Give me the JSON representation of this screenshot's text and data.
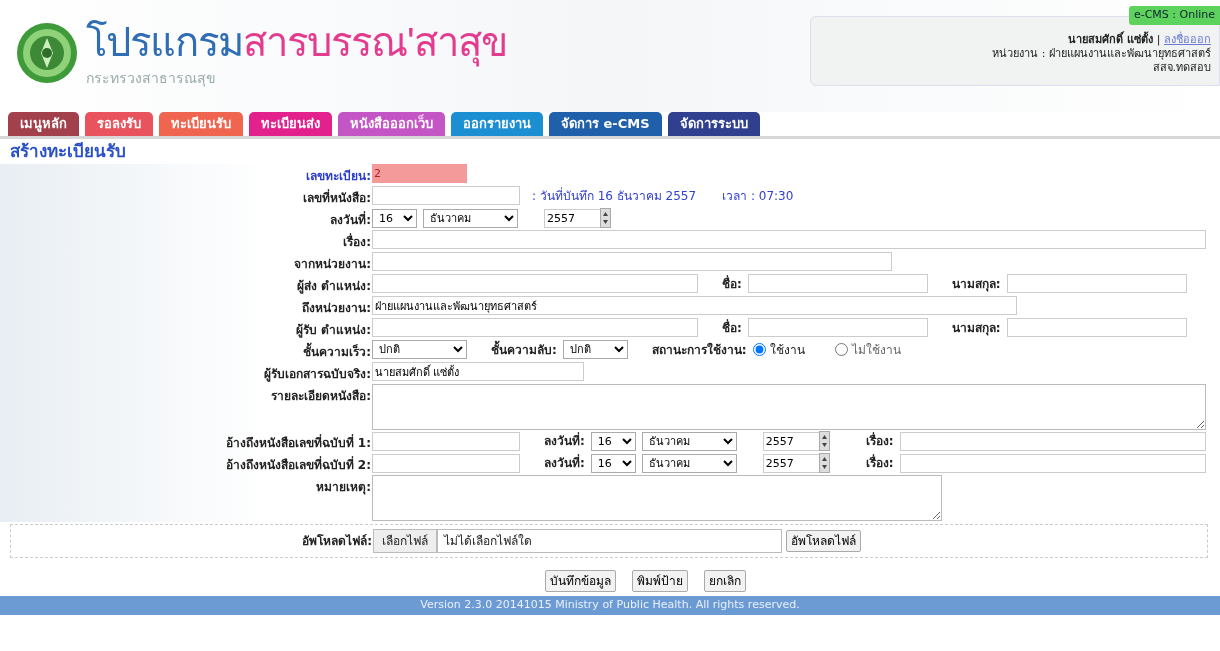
{
  "header": {
    "title_main": "โปรแกรม",
    "title_accent": "สารบรรณ'สาสุข",
    "subtitle": "กระทรวงสาธารณสุข",
    "user_panel": {
      "status": "e-CMS : Online",
      "user": "นายสมศักดิ์ แซ่ตั้ง",
      "separator": "|",
      "logout": "ลงชื่อออก",
      "unit": "หน่วยงาน : ฝ่ายแผนงานและพัฒนายุทธศาสตร์",
      "office": "สสจ.ทดสอบ"
    }
  },
  "tabs": [
    {
      "label": "เมนูหลัก",
      "color": "#a2404c"
    },
    {
      "label": "รอลงรับ",
      "color": "#e9535d"
    },
    {
      "label": "ทะเบียนรับ",
      "color": "#f0654f"
    },
    {
      "label": "ทะเบียนส่ง",
      "color": "#e2218c"
    },
    {
      "label": "หนังสือออกเว็บ",
      "color": "#c455c4"
    },
    {
      "label": "ออกรายงาน",
      "color": "#1b8fd2"
    },
    {
      "label": "จัดการ e-CMS",
      "color": "#2060aa"
    },
    {
      "label": "จัดการระบบ",
      "color": "#303f8e"
    }
  ],
  "page_title": "สร้างทะเบียนรับ",
  "form_rows": [
    {
      "kind": "register",
      "label": "เลขทะเบียน:",
      "controls": [
        {
          "kind": "input",
          "value": "2"
        }
      ]
    },
    {
      "kind": "normal",
      "label": "เลขที่หนังสือ:",
      "controls": [
        {
          "kind": "input"
        },
        {
          "kind": "info",
          "text": ": วันที่บันทึก 16 ธันวาคม 2557"
        },
        {
          "kind": "info",
          "text": "เวลา : 07:30"
        }
      ]
    },
    {
      "kind": "normal",
      "label": "ลงวันที่:",
      "controls": [
        {
          "kind": "select",
          "value": "16"
        },
        {
          "kind": "select",
          "value": "ธันวาคม"
        },
        {
          "kind": "year",
          "value": "2557"
        }
      ]
    },
    {
      "kind": "normal",
      "label": "เรื่อง:",
      "controls": [
        {
          "kind": "input"
        }
      ]
    },
    {
      "kind": "normal",
      "label": "จากหน่วยงาน:",
      "controls": [
        {
          "kind": "input"
        }
      ]
    },
    {
      "kind": "normal",
      "label": "ผู้ส่ง ตำแหน่ง:",
      "controls": [
        {
          "kind": "input"
        },
        {
          "kind": "label",
          "text": "ชื่อ:"
        },
        {
          "kind": "input"
        },
        {
          "kind": "label",
          "text": "นามสกุล:"
        },
        {
          "kind": "input"
        }
      ]
    },
    {
      "kind": "normal",
      "label": "ถึงหน่วยงาน:",
      "controls": [
        {
          "kind": "readonly",
          "value": "ฝ่ายแผนงานและพัฒนายุทธศาสตร์"
        }
      ]
    },
    {
      "kind": "normal",
      "label": "ผู้รับ ตำแหน่ง:",
      "controls": [
        {
          "kind": "input"
        },
        {
          "kind": "label",
          "text": "ชื่อ:"
        },
        {
          "kind": "input"
        },
        {
          "kind": "label",
          "text": "นามสกุล:"
        },
        {
          "kind": "input"
        }
      ]
    },
    {
      "kind": "normal",
      "label": "ชั้นความเร็ว:",
      "controls": [
        {
          "kind": "select",
          "value": "ปกติ"
        },
        {
          "kind": "label",
          "text": "ชั้นความลับ:"
        },
        {
          "kind": "select",
          "value": "ปกติ"
        },
        {
          "kind": "label",
          "text": "สถานะการใช้งาน:"
        },
        {
          "kind": "radio",
          "label": "ใช้งาน",
          "selected": true
        },
        {
          "kind": "radio",
          "label": "ไม่ใช้งาน",
          "selected": false
        }
      ]
    },
    {
      "kind": "normal",
      "label": "ผู้รับเอกสารฉบับจริง:",
      "controls": [
        {
          "kind": "readonly",
          "value": "นายสมศักดิ์ แซ่ตั้ง"
        }
      ]
    },
    {
      "kind": "normal",
      "label": "รายละเอียดหนังสือ:",
      "controls": [
        {
          "kind": "textarea"
        }
      ]
    },
    {
      "kind": "normal",
      "label": "อ้างถึงหนังสือเลขที่ฉบับที่ 1:",
      "controls": [
        {
          "kind": "input"
        },
        {
          "kind": "label",
          "text": "ลงวันที่:"
        },
        {
          "kind": "select",
          "value": "16"
        },
        {
          "kind": "select",
          "value": "ธันวาคม"
        },
        {
          "kind": "year",
          "value": "2557"
        },
        {
          "kind": "label",
          "text": "เรื่อง:"
        },
        {
          "kind": "input"
        }
      ]
    },
    {
      "kind": "normal",
      "label": "อ้างถึงหนังสือเลขที่ฉบับที่ 2:",
      "controls": [
        {
          "kind": "input"
        },
        {
          "kind": "label",
          "text": "ลงวันที่:"
        },
        {
          "kind": "select",
          "value": "16"
        },
        {
          "kind": "select",
          "value": "ธันวาคม"
        },
        {
          "kind": "year",
          "value": "2557"
        },
        {
          "kind": "label",
          "text": "เรื่อง:"
        },
        {
          "kind": "input"
        }
      ]
    },
    {
      "kind": "normal",
      "label": "หมายเหตุ:",
      "controls": [
        {
          "kind": "textarea"
        }
      ]
    }
  ],
  "upload": {
    "label": "อัพโหลดไฟล์:",
    "choose_button": "เลือกไฟล์",
    "file_name": "ไม่ได้เลือกไฟล์ใด",
    "upload_button": "อัพโหลดไฟล์"
  },
  "buttons": [
    "บันทึกข้อมูล",
    "พิมพ์ป้าย",
    "ยกเลิก"
  ],
  "footer": "Version 2.3.0 20141015 Ministry of Public Health. All rights reserved."
}
